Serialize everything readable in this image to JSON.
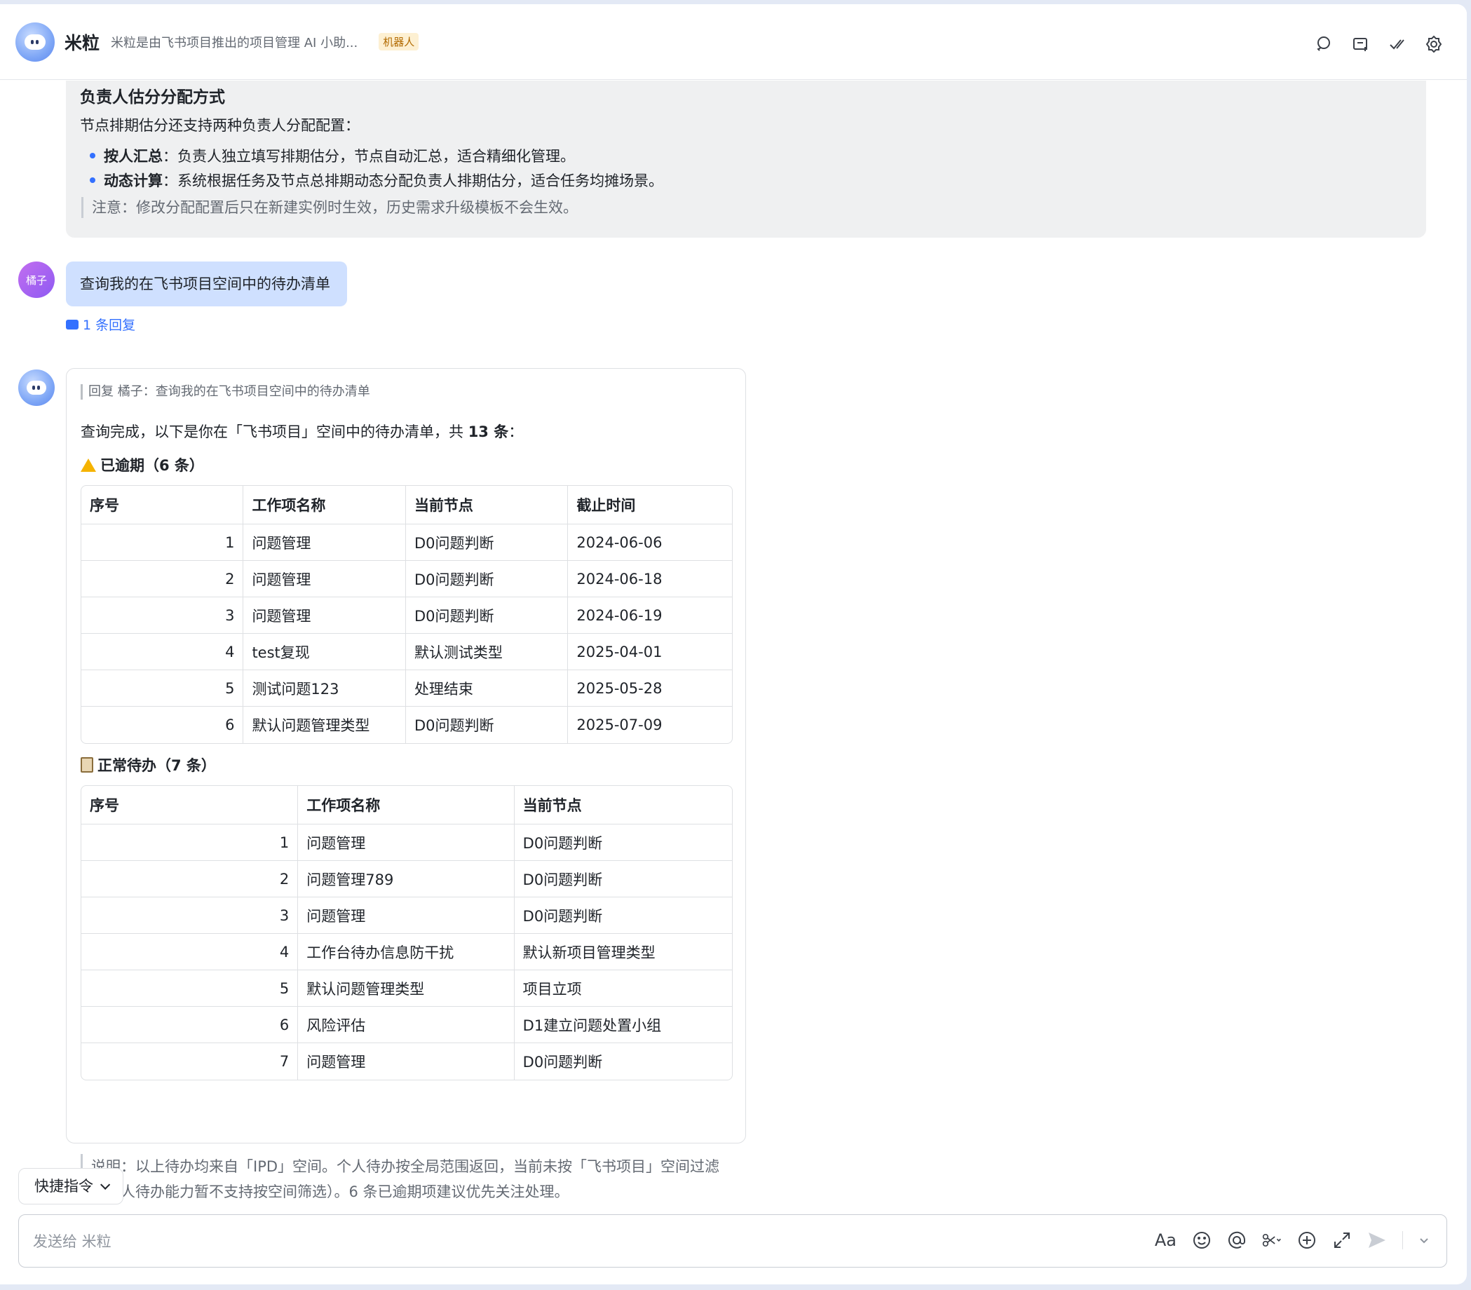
{
  "header": {
    "bot_name": "米粒",
    "description": "米粒是由飞书项目推出的项目管理 AI 小助...",
    "tag": "机器人"
  },
  "prev_message": {
    "title": "负责人估分分配方式",
    "intro": "节点排期估分还支持两种负责人分配配置：",
    "items": [
      {
        "bold": "按人汇总",
        "text": "：负责人独立填写排期估分，节点自动汇总，适合精细化管理。"
      },
      {
        "bold": "动态计算",
        "text": "：系统根据任务及节点总排期动态分配负责人排期估分，适合任务均摊场景。"
      }
    ],
    "note": "注意：修改分配配置后只在新建实例时生效，历史需求升级模板不会生效。"
  },
  "user_message": {
    "avatar_label": "橘子",
    "text": "查询我的在飞书项目空间中的待办清单",
    "reply_count": "1 条回复"
  },
  "bot_reply": {
    "quote": "回复 橘子：查询我的在飞书项目空间中的待办清单",
    "intro_prefix": "查询完成，以下是你在「飞书项目」空间中的待办清单，共 ",
    "intro_count": "13 条",
    "intro_suffix": "：",
    "overdue": {
      "title": "已逾期（6 条）",
      "headers": [
        "序号",
        "工作项名称",
        "当前节点",
        "截止时间"
      ],
      "rows": [
        [
          "1",
          "问题管理",
          "D0问题判断",
          "2024-06-06"
        ],
        [
          "2",
          "问题管理",
          "D0问题判断",
          "2024-06-18"
        ],
        [
          "3",
          "问题管理",
          "D0问题判断",
          "2024-06-19"
        ],
        [
          "4",
          "test复现",
          "默认测试类型",
          "2025-04-01"
        ],
        [
          "5",
          "测试问题123",
          "处理结束",
          "2025-05-28"
        ],
        [
          "6",
          "默认问题管理类型",
          "D0问题判断",
          "2025-07-09"
        ]
      ]
    },
    "normal": {
      "title": "正常待办（7 条）",
      "headers": [
        "序号",
        "工作项名称",
        "当前节点"
      ],
      "rows": [
        [
          "1",
          "问题管理",
          "D0问题判断"
        ],
        [
          "2",
          "问题管理789",
          "D0问题判断"
        ],
        [
          "3",
          "问题管理",
          "D0问题判断"
        ],
        [
          "4",
          "工作台待办信息防干扰",
          "默认新项目管理类型"
        ],
        [
          "5",
          "默认问题管理类型",
          "项目立项"
        ],
        [
          "6",
          "风险评估",
          "D1建立问题处置小组"
        ],
        [
          "7",
          "问题管理",
          "D0问题判断"
        ]
      ]
    },
    "note": "说明：以上待办均来自「IPD」空间。个人待办按全局范围返回，当前未按「飞书项目」空间过滤（个人待办能力暂不支持按空间筛选）。6 条已逾期项建议优先关注处理。"
  },
  "composer": {
    "quick_label": "快捷指令",
    "placeholder": "发送给 米粒",
    "font_button": "Aa"
  },
  "colors": {
    "accent": "#3370ff",
    "user_bubble": "#cfe0ff",
    "card_bg": "#eff0f1"
  }
}
